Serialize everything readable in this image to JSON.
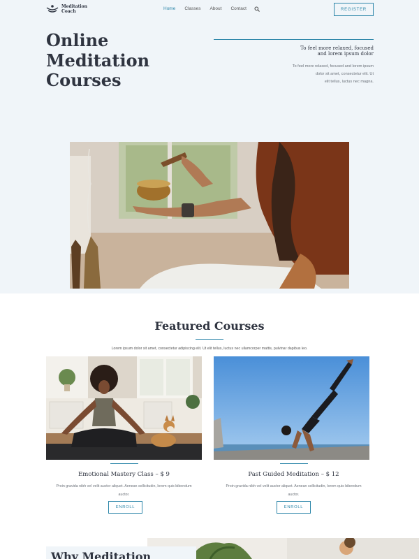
{
  "header": {
    "logo_line1": "Meditation",
    "logo_line2": "Coach",
    "nav": [
      "Home",
      "Classes",
      "About",
      "Contact"
    ],
    "register_label": "REGISTER"
  },
  "hero": {
    "title_line1": "Online",
    "title_line2": "Meditation",
    "title_line3": "Courses",
    "subtitle_line1": "To feel more relaxed, focused",
    "subtitle_line2": "and lorem ipsum dolor",
    "body_line1": "To feel more relaxed, focused and lorem ipsum",
    "body_line2": "dolor sit amet, consectetur elit. Ut",
    "body_line3": "elit tellus, luctus nec magna."
  },
  "featured": {
    "title": "Featured Courses",
    "description": "Lorem ipsum dolor sit amet, consectetur adipiscing elit. Ut elit tellus, luctus nec ullamcorper mattis, pulvinar dapibus leo.",
    "courses": [
      {
        "title": "Emotional Mastery Class – $ 9",
        "desc_line1": "Proin gravida nibh vel velit auctor aliquet. Aenean sollicitudin, lorem quis bibendum",
        "desc_line2": "auctor.",
        "button": "ENROLL"
      },
      {
        "title": "Past Guided Meditation – $ 12",
        "desc_line1": "Proin gravida nibh vel velit auctor aliquet. Aenean sollicitudin, lorem quis bibendum",
        "desc_line2": "auctor.",
        "button": "ENROLL"
      }
    ]
  },
  "why": {
    "title": "Why Meditation"
  },
  "colors": {
    "accent": "#2c86a9",
    "heading": "#2f3440",
    "hero_bg": "#f0f5f9"
  }
}
